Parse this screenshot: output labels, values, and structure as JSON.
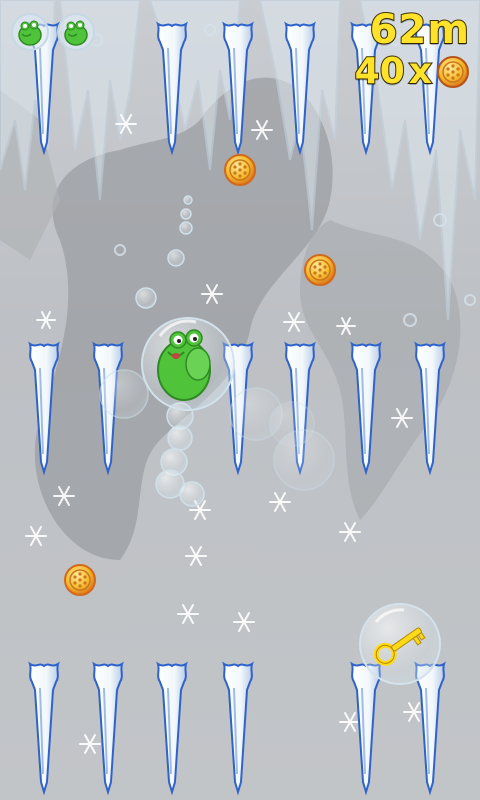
{
  "hud": {
    "distance": "62",
    "distance_unit": "m",
    "coins_count": "40",
    "coins_multiplier": "x",
    "lives_remaining": 2
  },
  "game": {
    "player": "frog-in-bubble",
    "collectibles": [
      "coin",
      "coin",
      "coin",
      "key-bubble"
    ],
    "obstacles": "icicles",
    "colors": {
      "hud_text": "#ffe229",
      "coin": "#f0a818",
      "frog": "#4fc43a",
      "icicle": "#ffffff",
      "icicle_edge": "#2f63c9",
      "key": "#ffd91a"
    }
  }
}
